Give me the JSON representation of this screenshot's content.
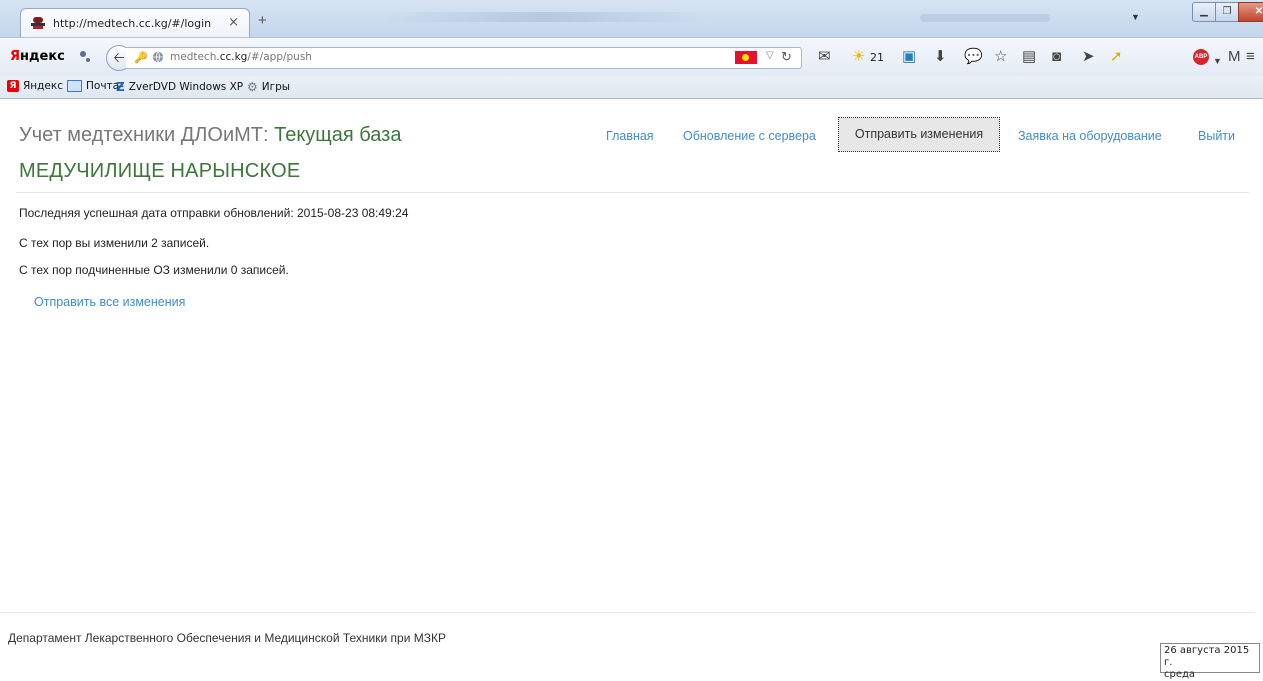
{
  "browser": {
    "tab_title": "http://medtech.cc.kg/#/login",
    "tab_close": "×",
    "new_tab": "+",
    "url_prefix": "medtech.",
    "url_domain": "cc.kg",
    "url_path": "/#/app/push",
    "yandex_logo_first": "Я",
    "yandex_logo_rest": "ндекс",
    "weather_value": "21",
    "bookmarks": [
      {
        "label": "Яндекс",
        "icon": "yandex-icon"
      },
      {
        "label": "Почта",
        "icon": "mail-icon"
      },
      {
        "label": "ZverDVD Windows XP",
        "icon": "zverdvd-icon"
      },
      {
        "label": "Игры",
        "icon": "games-icon"
      }
    ]
  },
  "header": {
    "title_prefix": "Учет медтехники ДЛОиМТ: ",
    "title_db": "Текущая база",
    "subtitle": "МЕДУЧИЛИЩЕ НАРЫНСКОЕ"
  },
  "nav": {
    "home": "Главная",
    "update": "Обновление с сервера",
    "send": "Отправить изменения",
    "request": "Заявка на оборудование",
    "logout": "Выйти"
  },
  "main": {
    "last_sent": "Последняя успешная дата отправки обновлений: 2015-08-23 08:49:24",
    "changed_you": "С тех пор вы изменили 2 записей.",
    "changed_sub": "С тех пор подчиненные ОЗ изменили 0 записей.",
    "send_all": "Отправить все изменения"
  },
  "footer": {
    "text": "Департамент Лекарственного Обеспечения и Медицинской Техники при МЗКР"
  },
  "clock": {
    "date": "26 августа 2015 г.",
    "day": "среда"
  },
  "colors": {
    "link": "#428bca",
    "db_green": "#3c763d",
    "title_gray": "#777777"
  }
}
